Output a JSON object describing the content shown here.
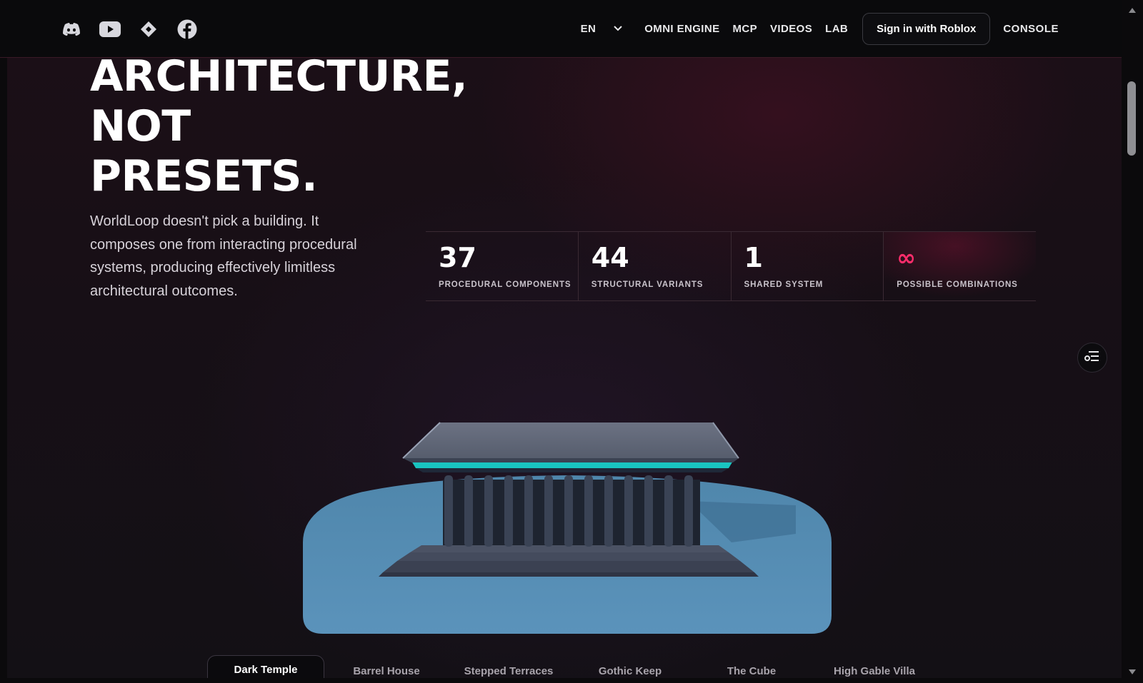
{
  "social": {
    "icons": [
      "discord-icon",
      "youtube-icon",
      "diamond-icon",
      "facebook-icon"
    ]
  },
  "nav": {
    "language": "EN",
    "items": [
      "OMNI ENGINE",
      "MCP",
      "VIDEOS",
      "LAB"
    ],
    "signin": "Sign in with Roblox",
    "console": "CONSOLE"
  },
  "hero": {
    "headline": [
      "ARCHITECTURE,",
      "NOT",
      "PRESETS."
    ],
    "intro": "WorldLoop doesn't pick a building. It composes one from interacting procedural systems, producing effectively limitless architectural outcomes."
  },
  "stats": [
    {
      "value": "37",
      "label": "PROCEDURAL COMPONENTS"
    },
    {
      "value": "44",
      "label": "STRUCTURAL VARIANTS"
    },
    {
      "value": "1",
      "label": "SHARED SYSTEM"
    },
    {
      "value": "∞",
      "label": "POSSIBLE COMBINATIONS"
    }
  ],
  "tabs": [
    "Dark Temple",
    "Barrel House",
    "Stepped Terraces",
    "Gothic Keep",
    "The Cube",
    "High Gable Villa"
  ],
  "active_tab": "Dark Temple",
  "colors": {
    "accent": "#ff2d6b",
    "background": "#170f16",
    "platform": "#4f86ab",
    "roof_trim": "#19c4c0"
  }
}
